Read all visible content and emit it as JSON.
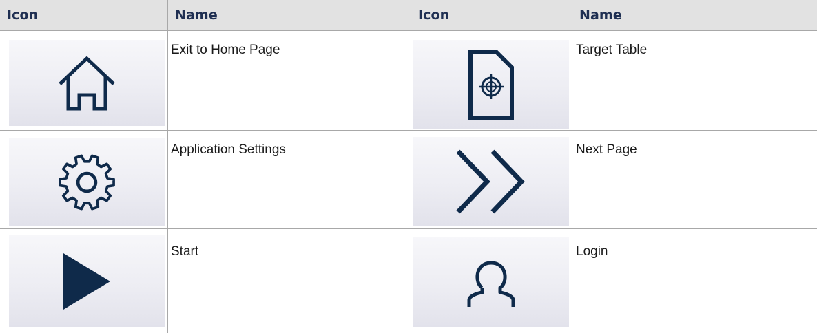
{
  "headers": [
    "Icon",
    "Name",
    "Icon",
    "Name"
  ],
  "rows": [
    {
      "left": {
        "icon": "home-icon",
        "name": "Exit to Home Page"
      },
      "right": {
        "icon": "target-table-icon",
        "name": "Target Table"
      }
    },
    {
      "left": {
        "icon": "gear-icon",
        "name": "Application Settings"
      },
      "right": {
        "icon": "double-chevron-right-icon",
        "name": "Next Page"
      }
    },
    {
      "left": {
        "icon": "play-icon",
        "name": "Start"
      },
      "right": {
        "icon": "user-icon",
        "name": "Login"
      }
    }
  ],
  "colors": {
    "header_bg": "#e2e2e2",
    "header_text": "#1f2f52",
    "icon_color": "#0f2a4a",
    "border": "#a8a8a8"
  }
}
